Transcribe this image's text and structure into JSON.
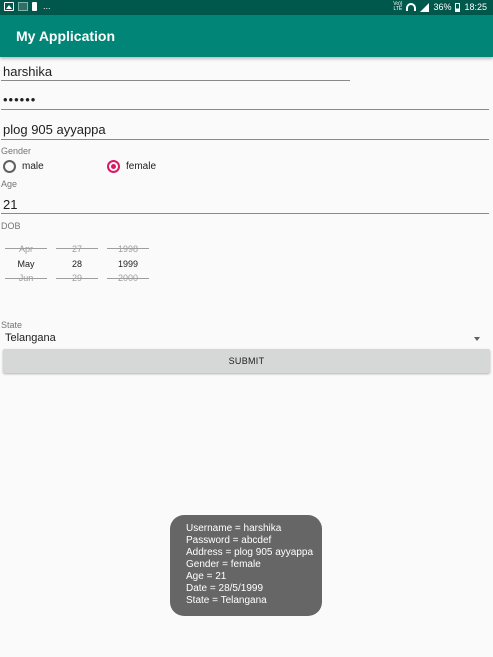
{
  "status_bar": {
    "left_icons": [
      "image-icon",
      "app-icon",
      "key-icon"
    ],
    "more": "...",
    "lte_top": "Vo))",
    "lte_bottom": "LTE",
    "battery": "36%",
    "time": "18:25"
  },
  "app_bar": {
    "title": "My Application"
  },
  "form": {
    "username": "harshika",
    "password": "••••••",
    "address": "plog 905 ayyappa",
    "gender_label": "Gender",
    "gender_options": [
      {
        "label": "male",
        "checked": false
      },
      {
        "label": "female",
        "checked": true
      }
    ],
    "age_label": "Age",
    "age": "21",
    "dob_label": "DOB",
    "dob_picker": {
      "month": {
        "prev": "Apr",
        "selected": "May",
        "next": "Jun"
      },
      "day": {
        "prev": "27",
        "selected": "28",
        "next": "29"
      },
      "year": {
        "prev": "1998",
        "selected": "1999",
        "next": "2000"
      }
    },
    "state_label": "State",
    "state_value": "Telangana",
    "submit_label": "SUBMIT"
  },
  "toast": {
    "lines": [
      "Username = harshika",
      "Password = abcdef",
      "Address = plog 905 ayyappa",
      "Gender = female",
      "Age = 21",
      "Date = 28/5/1999",
      "State = Telangana"
    ]
  },
  "colors": {
    "status_bar": "#00574b",
    "app_bar": "#008577",
    "accent": "#d81b60",
    "toast_bg": "#666666"
  }
}
